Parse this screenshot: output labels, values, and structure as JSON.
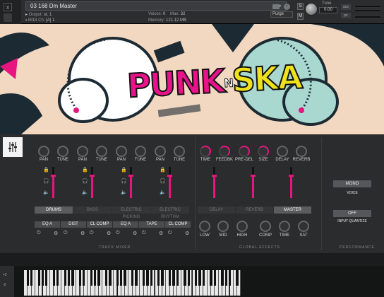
{
  "header": {
    "close_glyph": "x",
    "instrument_title": "03 168 Dm Master",
    "output_label": "Output:",
    "output_value": "st. 1",
    "midi_label": "MIDI Ch:",
    "midi_value": "[A] 1",
    "voices_label": "Voices:",
    "voices_value": "0",
    "max_label": "Max:",
    "max_value": "32",
    "memory_label": "Memory:",
    "memory_value": "121.12 MB",
    "purge_label": "Purge",
    "solo_label": "S",
    "mute_label": "M",
    "tune_label": "Tune",
    "tune_value": "0.00",
    "aux_label": "aux",
    "pv_label": "pv"
  },
  "banner": {
    "logo_part1": "PUNK",
    "logo_part2": "N",
    "logo_part3": "SKA",
    "accent_pink": "#e6157f",
    "accent_yellow": "#eee21a",
    "cloud_white": "#ffffff",
    "cloud_teal": "#a9d8d1"
  },
  "mixer": {
    "channels": [
      {
        "k1": "PAN",
        "k2": "TUNE"
      },
      {
        "k1": "PAN",
        "k2": "TUNE"
      },
      {
        "k1": "PAN",
        "k2": "TUNE"
      },
      {
        "k1": "PAN",
        "k2": "TUNE"
      }
    ],
    "fader_levels": [
      0.72,
      0.72,
      0.72,
      0.72
    ],
    "tabs": [
      "DRUMS",
      "BASS",
      "ELECTRIC PICKING",
      "ELECTRIC RHYTHM"
    ],
    "active_tab": 0,
    "fx_buttons": [
      "EQ A",
      "DIST",
      "CL COMP",
      "EQ A",
      "TAPE",
      "CL COMP"
    ],
    "section_label": "TRACK MIXER"
  },
  "global_fx": {
    "top_knobs": [
      "TIME",
      "FEEDBK",
      "PRE-DEL",
      "SIZE",
      "DELAY",
      "REVERB"
    ],
    "fader_levels": [
      0.72,
      0.72,
      0.72
    ],
    "tabs": [
      "DELAY",
      "REVERB",
      "MASTER"
    ],
    "active_tab": 2,
    "bottom_knobs": [
      "LOW",
      "MID",
      "HIGH",
      "COMP",
      "TIME",
      "SAT"
    ],
    "section_label": "GLOBAL EFFECTS"
  },
  "performance": {
    "mono_label": "MONO",
    "voice_label": "VOICE",
    "off_label": "OFF",
    "quantize_label": "INPUT QUANTIZE",
    "section_label": "PERFORMANCE"
  },
  "keyboard": {
    "plus_label": "+2",
    "minus_label": "-2"
  }
}
